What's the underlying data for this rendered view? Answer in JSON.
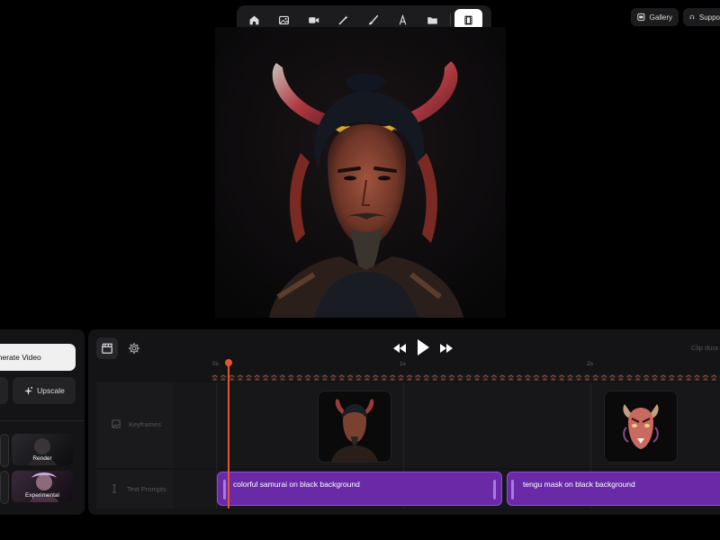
{
  "toolbar": {
    "tools": [
      {
        "name": "home-icon"
      },
      {
        "name": "image-icon"
      },
      {
        "name": "video-camera-icon"
      },
      {
        "name": "magic-wand-icon"
      },
      {
        "name": "brush-icon"
      },
      {
        "name": "text-icon"
      },
      {
        "name": "folder-icon"
      },
      {
        "name": "film-icon",
        "active": true
      }
    ]
  },
  "header": {
    "gallery_label": "Gallery",
    "support_label": "Suppo"
  },
  "left_panel": {
    "generate_label": "enerate Video",
    "upscale_label": "Upscale",
    "styles": [
      {
        "label": "Render"
      },
      {
        "label": "Experimental"
      }
    ]
  },
  "timeline": {
    "clip_duration_label": "Clip dura",
    "ticks": [
      "0s",
      "1s",
      "2s"
    ],
    "tracks": {
      "keyframes_label": "Keyframes",
      "text_prompts_label": "Text Prompts"
    },
    "prompts": [
      {
        "text": "colorful samurai on black background"
      },
      {
        "text": "tengu mask on black background"
      }
    ]
  },
  "colors": {
    "accent_purple": "#6a2aa8",
    "playhead": "#e4572e",
    "panel": "#141416"
  }
}
